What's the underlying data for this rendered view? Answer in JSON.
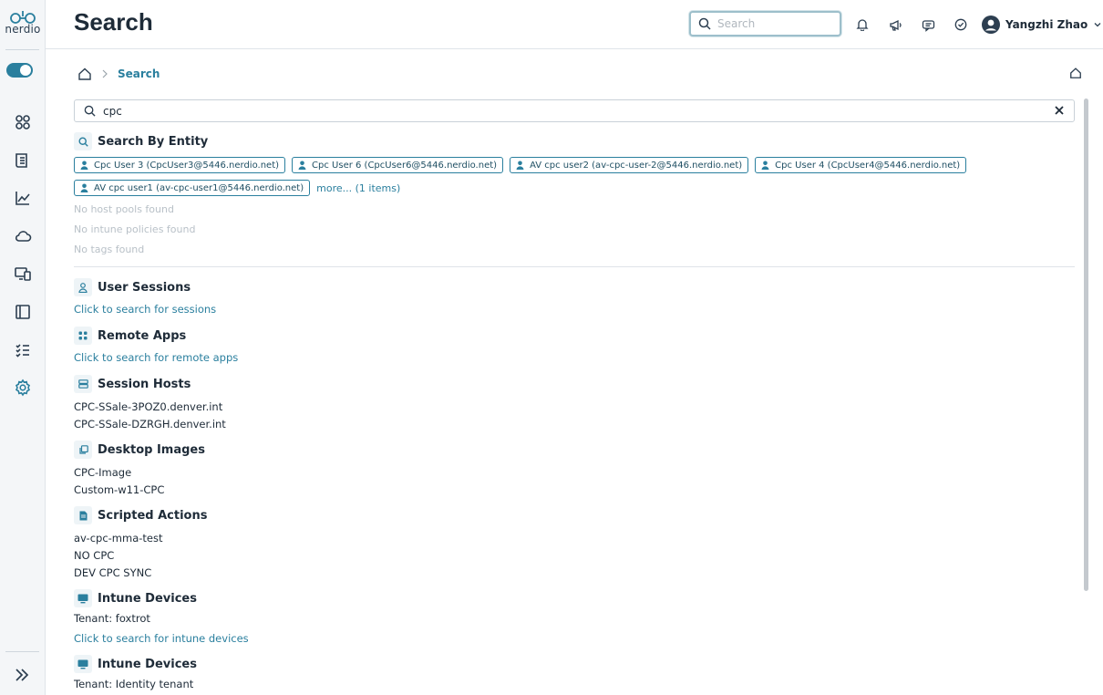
{
  "brand": {
    "name": "nerdio",
    "accent": "#2a7f9e"
  },
  "header": {
    "title": "Search",
    "search_placeholder": "Search",
    "user_name": "Yangzhi Zhao",
    "icons": [
      "bell-icon",
      "megaphone-icon",
      "chat-icon",
      "check-circle-icon",
      "user-avatar-icon",
      "chevron-down-icon"
    ]
  },
  "sidebar": {
    "items": [
      {
        "icon": "dashboard-icon"
      },
      {
        "icon": "document-icon"
      },
      {
        "icon": "chart-icon"
      },
      {
        "icon": "cloud-icon"
      },
      {
        "icon": "devices-icon"
      },
      {
        "icon": "layout-icon"
      },
      {
        "icon": "checklist-icon"
      },
      {
        "icon": "settings-icon"
      }
    ]
  },
  "breadcrumb": {
    "current": "Search"
  },
  "filter": {
    "value": "cpc"
  },
  "entity": {
    "title": "Search By Entity",
    "chips": [
      "Cpc User 3 (CpcUser3@5446.nerdio.net)",
      "Cpc User 6 (CpcUser6@5446.nerdio.net)",
      "AV cpc user2 (av-cpc-user-2@5446.nerdio.net)",
      "Cpc User 4 (CpcUser4@5446.nerdio.net)",
      "AV cpc user1 (av-cpc-user1@5446.nerdio.net)"
    ],
    "more": "more... (1 items)",
    "no_host_pools": "No host pools found",
    "no_intune_policies": "No intune policies found",
    "no_tags": "No tags found"
  },
  "sections": {
    "user_sessions": {
      "title": "User Sessions",
      "link": "Click to search for sessions"
    },
    "remote_apps": {
      "title": "Remote Apps",
      "link": "Click to search for remote apps"
    },
    "session_hosts": {
      "title": "Session Hosts",
      "items": [
        "CPC-SSale-3POZ0.denver.int",
        "CPC-SSale-DZRGH.denver.int"
      ]
    },
    "desktop_images": {
      "title": "Desktop Images",
      "items": [
        "CPC-Image",
        "Custom-w11-CPC"
      ]
    },
    "scripted_actions": {
      "title": "Scripted Actions",
      "items": [
        "av-cpc-mma-test",
        "NO CPC",
        "DEV CPC SYNC"
      ]
    },
    "intune_devices_1": {
      "title": "Intune Devices",
      "tenant": "Tenant: foxtrot",
      "link": "Click to search for intune devices"
    },
    "intune_devices_2": {
      "title": "Intune Devices",
      "tenant": "Tenant: Identity tenant"
    }
  }
}
